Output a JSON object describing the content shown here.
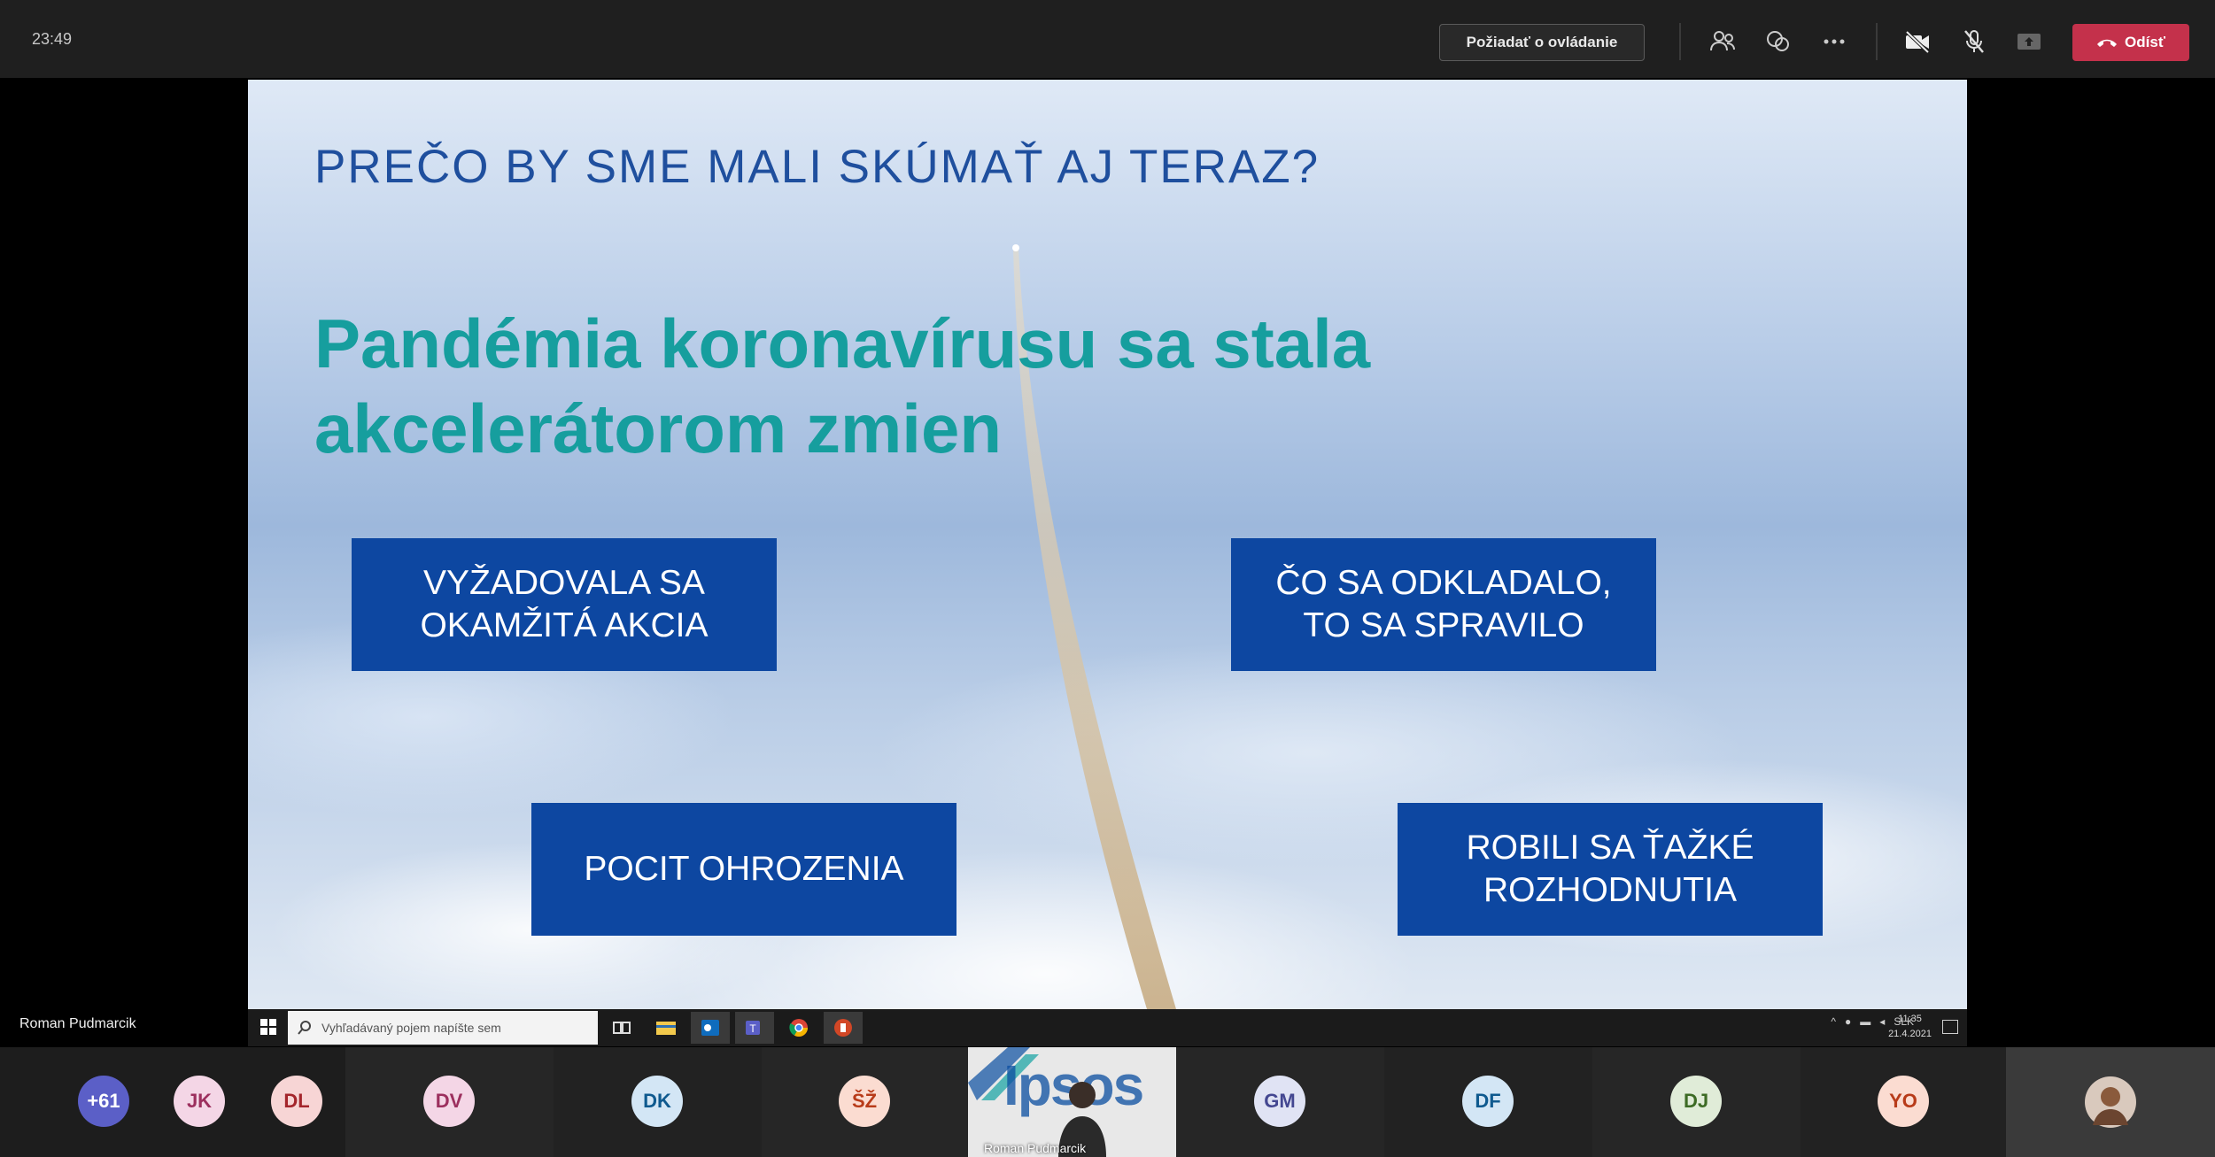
{
  "topbar": {
    "timer": "23:49",
    "request_control_label": "Požiadať o ovládanie",
    "leave_label": "Odísť",
    "colors": {
      "bar": "#1f1f1f",
      "leave": "#c4314b"
    }
  },
  "slide": {
    "title": "PREČO BY SME MALI SKÚMAŤ AJ TERAZ?",
    "headline_line1": "Pandémia koronavírusu sa stala",
    "headline_line2": "akcelerátorom zmien",
    "boxes": [
      {
        "line1": "VYŽADOVALA SA",
        "line2": "OKAMŽITÁ AKCIA"
      },
      {
        "line1": "ČO SA ODKLADALO,",
        "line2": "TO SA SPRAVILO"
      },
      {
        "line1": "POCIT OHROZENIA",
        "line2": ""
      },
      {
        "line1": "ROBILI SA ŤAŽKÉ",
        "line2": "ROZHODNUTIA"
      }
    ],
    "colors": {
      "title": "#1f4f9e",
      "headline": "#169e9e",
      "box": "#0d47a1"
    }
  },
  "presenter_name": "Roman Pudmarcik",
  "windows_taskbar": {
    "search_placeholder": "Vyhľadávaný pojem napíšte sem",
    "language": "SLK",
    "time": "11:35",
    "date": "21.4.2021"
  },
  "participants": [
    {
      "initials": "+61",
      "bg": "#5b5fc7",
      "fg": "#ffffff"
    },
    {
      "initials": "JK",
      "bg": "#f4d6e6",
      "fg": "#9c2f5e"
    },
    {
      "initials": "DL",
      "bg": "#f7d5d5",
      "fg": "#a4262c"
    },
    {
      "initials": "DV",
      "bg": "#f4d6e6",
      "fg": "#9c2f5e"
    },
    {
      "initials": "DK",
      "bg": "#d3e6f5",
      "fg": "#0f5a8f"
    },
    {
      "initials": "ŠŽ",
      "bg": "#fbdcd1",
      "fg": "#b83b19"
    },
    {
      "initials": "GM",
      "bg": "#e0e3f4",
      "fg": "#444791"
    },
    {
      "initials": "DF",
      "bg": "#d3e6f5",
      "fg": "#0f5a8f"
    },
    {
      "initials": "DJ",
      "bg": "#e0ecd8",
      "fg": "#3d6b25"
    },
    {
      "initials": "YO",
      "bg": "#fbdcd1",
      "fg": "#b83b19"
    }
  ],
  "video_tile": {
    "logo_text": "Ipsos",
    "name": "Roman Pudmarcik"
  }
}
